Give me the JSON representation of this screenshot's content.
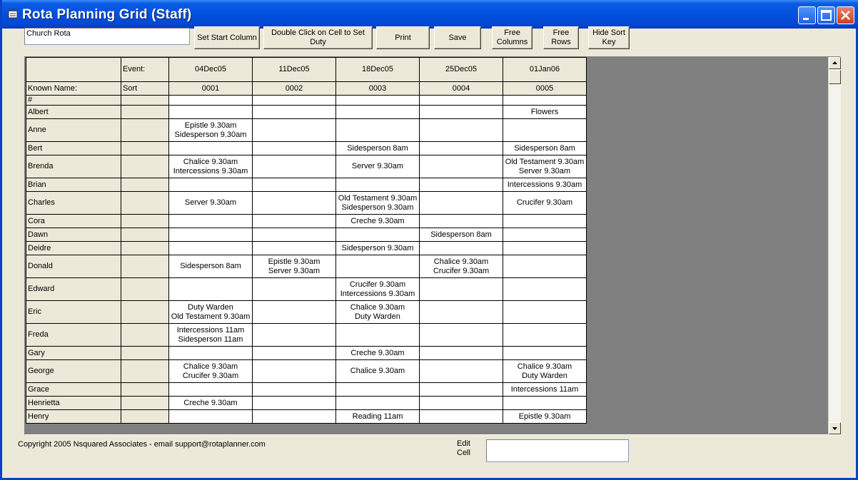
{
  "window": {
    "title": "Rota Planning Grid (Staff)"
  },
  "toolbar": {
    "rota_name": "Church Rota",
    "set_start_column": "Set Start Column",
    "double_click_hint": "Double Click on Cell to Set\nDuty",
    "print": "Print",
    "save": "Save",
    "free_columns": "Free\nColumns",
    "free_rows": "Free\nRows",
    "hide_sort_key": "Hide Sort\nKey"
  },
  "grid": {
    "event_label": "Event:",
    "known_name_label": "Known Name:",
    "sort_label": "Sort",
    "columns": [
      {
        "date": "04Dec05",
        "code": "0001"
      },
      {
        "date": "11Dec05",
        "code": "0002"
      },
      {
        "date": "18Dec05",
        "code": "0003"
      },
      {
        "date": "25Dec05",
        "code": "0004"
      },
      {
        "date": "01Jan06",
        "code": "0005"
      }
    ],
    "rows": [
      {
        "name": "#",
        "duties": [
          "",
          "",
          "",
          "",
          ""
        ]
      },
      {
        "name": "Albert",
        "duties": [
          "",
          "",
          "",
          "",
          "Flowers"
        ]
      },
      {
        "name": "Anne",
        "duties": [
          "Epistle 9.30am\nSidesperson 9.30am",
          "",
          "",
          "",
          ""
        ]
      },
      {
        "name": "Bert",
        "duties": [
          "",
          "",
          "Sidesperson 8am",
          "",
          "Sidesperson 8am"
        ]
      },
      {
        "name": "Brenda",
        "duties": [
          "Chalice 9.30am\nIntercessions 9.30am",
          "",
          "Server 9.30am",
          "",
          "Old Testament 9.30am\nServer 9.30am"
        ]
      },
      {
        "name": "Brian",
        "duties": [
          "",
          "",
          "",
          "",
          "Intercessions 9.30am"
        ]
      },
      {
        "name": "Charles",
        "duties": [
          "Server 9.30am",
          "",
          "Old Testament 9.30am\nSidesperson 9.30am",
          "",
          "Crucifer 9.30am"
        ]
      },
      {
        "name": "Cora",
        "duties": [
          "",
          "",
          "Creche 9.30am",
          "",
          ""
        ]
      },
      {
        "name": "Dawn",
        "duties": [
          "",
          "",
          "",
          "Sidesperson 8am",
          ""
        ]
      },
      {
        "name": "Deidre",
        "duties": [
          "",
          "",
          "Sidesperson 9.30am",
          "",
          ""
        ]
      },
      {
        "name": "Donald",
        "duties": [
          "Sidesperson 8am",
          "Epistle 9.30am\nServer 9.30am",
          "",
          "Chalice 9.30am\nCrucifer 9.30am",
          ""
        ]
      },
      {
        "name": "Edward",
        "duties": [
          "",
          "",
          "Crucifer 9.30am\nIntercessions 9.30am",
          "",
          ""
        ]
      },
      {
        "name": "Eric",
        "duties": [
          "Duty Warden\nOld Testament 9.30am",
          "",
          "Chalice 9.30am\nDuty Warden",
          "",
          ""
        ]
      },
      {
        "name": "Freda",
        "duties": [
          "Intercessions 11am\nSidesperson 11am",
          "",
          "",
          "",
          ""
        ]
      },
      {
        "name": "Gary",
        "duties": [
          "",
          "",
          "Creche 9.30am",
          "",
          ""
        ]
      },
      {
        "name": "George",
        "duties": [
          "Chalice 9.30am\nCrucifer 9.30am",
          "",
          "Chalice 9.30am",
          "",
          "Chalice 9.30am\nDuty Warden"
        ]
      },
      {
        "name": "Grace",
        "duties": [
          "",
          "",
          "",
          "",
          "Intercessions 11am"
        ]
      },
      {
        "name": "Henrietta",
        "duties": [
          "Creche 9.30am",
          "",
          "",
          "",
          ""
        ]
      },
      {
        "name": "Henry",
        "duties": [
          "",
          "",
          "Reading 11am",
          "",
          "Epistle 9.30am"
        ]
      }
    ]
  },
  "footer": {
    "copyright": "Copyright 2005 Nsquared Associates - email support@rotaplanner.com",
    "edit_cell_label": "Edit\nCell",
    "edit_cell_value": ""
  }
}
